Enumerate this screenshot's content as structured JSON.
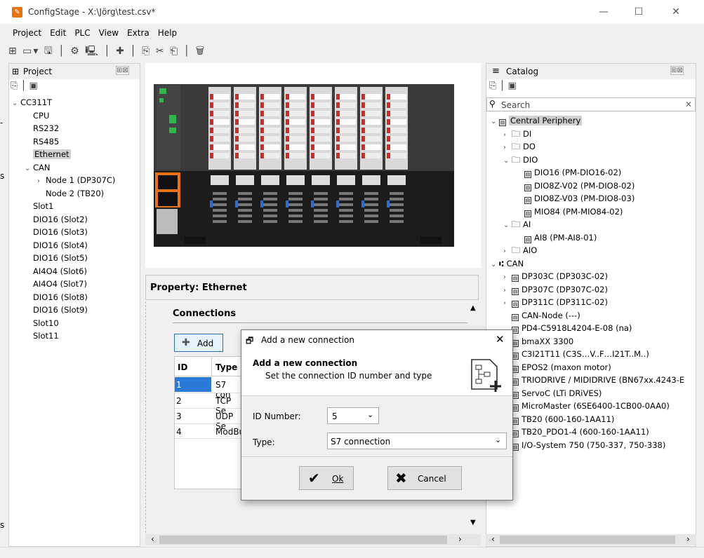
{
  "window": {
    "title": "ConfigStage - X:\\Jörg\\test.csv*",
    "buttons": [
      "—",
      "☐",
      "✕"
    ]
  },
  "menu": [
    "Project",
    "Edit",
    "PLC",
    "View",
    "Extra",
    "Help"
  ],
  "toolbar": "⊞ ▭▾ 🖫 │ ⚙ 🖳 │ ✚ │ ⎘ ✂ ⎗ │ 🗑",
  "project": {
    "header": "Project",
    "pin": "⊞⊠",
    "items": [
      {
        "t": "CC311T",
        "lvl": 0,
        "exp": "v"
      },
      {
        "t": "CPU",
        "lvl": 1
      },
      {
        "t": "RS232",
        "lvl": 1
      },
      {
        "t": "RS485",
        "lvl": 1
      },
      {
        "t": "Ethernet",
        "lvl": 1,
        "sel": true
      },
      {
        "t": "CAN",
        "lvl": 1,
        "exp": "v"
      },
      {
        "t": "Node 1 (DP307C)",
        "lvl": 2,
        "exp": ">"
      },
      {
        "t": "Node 2 (TB20)",
        "lvl": 2
      },
      {
        "t": "Slot1",
        "lvl": 1
      },
      {
        "t": "DIO16 (Slot2)",
        "lvl": 1
      },
      {
        "t": "DIO16 (Slot3)",
        "lvl": 1
      },
      {
        "t": "DIO16 (Slot4)",
        "lvl": 1
      },
      {
        "t": "DIO16 (Slot5)",
        "lvl": 1
      },
      {
        "t": "AI4O4 (Slot6)",
        "lvl": 1
      },
      {
        "t": "AI4O4 (Slot7)",
        "lvl": 1
      },
      {
        "t": "DIO16 (Slot8)",
        "lvl": 1
      },
      {
        "t": "DIO16 (Slot9)",
        "lvl": 1
      },
      {
        "t": "Slot10",
        "lvl": 1
      },
      {
        "t": "Slot11",
        "lvl": 1
      }
    ]
  },
  "property": {
    "title": "Property: Ethernet",
    "section": "Connections",
    "add_label": "Add",
    "columns": [
      "ID",
      "Type"
    ],
    "rows": [
      [
        "1",
        "S7 con"
      ],
      [
        "2",
        "TCP Se"
      ],
      [
        "3",
        "UDP Se"
      ],
      [
        "4",
        "ModBu"
      ]
    ]
  },
  "catalog": {
    "header": "Catalog",
    "pin": "⊞⊠",
    "search_placeholder": "Search",
    "items": [
      {
        "t": "Central Periphery",
        "lvl": 0,
        "exp": "v",
        "sel": true,
        "ico": "m"
      },
      {
        "t": "DI",
        "lvl": 1,
        "exp": ">",
        "ico": "f"
      },
      {
        "t": "DO",
        "lvl": 1,
        "exp": ">",
        "ico": "f"
      },
      {
        "t": "DIO",
        "lvl": 1,
        "exp": "v",
        "ico": "f"
      },
      {
        "t": "DIO16 (PM-DIO16-02)",
        "lvl": 2,
        "ico": "m"
      },
      {
        "t": "DIO8Z-V02 (PM-DIO8-02)",
        "lvl": 2,
        "ico": "m"
      },
      {
        "t": "DIO8Z-V03 (PM-DIO8-03)",
        "lvl": 2,
        "ico": "m"
      },
      {
        "t": "MIO84 (PM-MIO84-02)",
        "lvl": 2,
        "ico": "m"
      },
      {
        "t": "AI",
        "lvl": 1,
        "exp": "v",
        "ico": "f"
      },
      {
        "t": "AI8 (PM-AI8-01)",
        "lvl": 2,
        "ico": "m"
      },
      {
        "t": "AIO",
        "lvl": 1,
        "exp": ">",
        "ico": "f"
      },
      {
        "t": "CAN",
        "lvl": 0,
        "exp": "v",
        "ico": "n"
      },
      {
        "t": "DP303C (DP303C-02)",
        "lvl": 1,
        "exp": ">",
        "ico": "m"
      },
      {
        "t": "DP307C (DP307C-02)",
        "lvl": 1,
        "exp": ">",
        "ico": "m"
      },
      {
        "t": "DP311C (DP311C-02)",
        "lvl": 1,
        "exp": ">",
        "ico": "m"
      },
      {
        "t": "CAN-Node (---)",
        "lvl": 1,
        "ico": "m"
      },
      {
        "t": "PD4-C5918L4204-E-08 (na)",
        "lvl": 1,
        "ico": "m"
      },
      {
        "t": "bmaXX 3300",
        "lvl": 1,
        "ico": "m"
      },
      {
        "t": "C3I21T11 (C3S…V..F…I21T..M..)",
        "lvl": 1,
        "ico": "m"
      },
      {
        "t": "EPOS2 (maxon motor)",
        "lvl": 1,
        "ico": "m"
      },
      {
        "t": "TRIODRIVE / MIDIDRIVE (BN67xx.4243-E",
        "lvl": 1,
        "ico": "m"
      },
      {
        "t": "ServoC (LTi DRiVES)",
        "lvl": 1,
        "ico": "m"
      },
      {
        "t": "MicroMaster (6SE6400-1CB00-0AA0)",
        "lvl": 1,
        "ico": "m"
      },
      {
        "t": "TB20 (600-160-1AA11)",
        "lvl": 1,
        "ico": "m"
      },
      {
        "t": "TB20_PDO1-4 (600-160-1AA11)",
        "lvl": 1,
        "ico": "m"
      },
      {
        "t": "I/O-System 750 (750-337, 750-338)",
        "lvl": 1,
        "ico": "m"
      }
    ]
  },
  "dialog": {
    "title": "Add a new connection",
    "heading": "Add a new connection",
    "sub": "Set the connection ID number and type",
    "id_label": "ID Number:",
    "id_value": "5",
    "type_label": "Type:",
    "type_value": "S7 connection",
    "ok": "Ok",
    "cancel": "Cancel"
  },
  "colors": {
    "accent": "#e8730c",
    "selection": "#cfcfcf",
    "rack_dark": "#1c1c1c",
    "led_green": "#2fb84a",
    "led_red": "#d62828",
    "led_blue": "#2a6fd1"
  },
  "left_edge_fragments": [
    "-",
    "s",
    "s"
  ]
}
